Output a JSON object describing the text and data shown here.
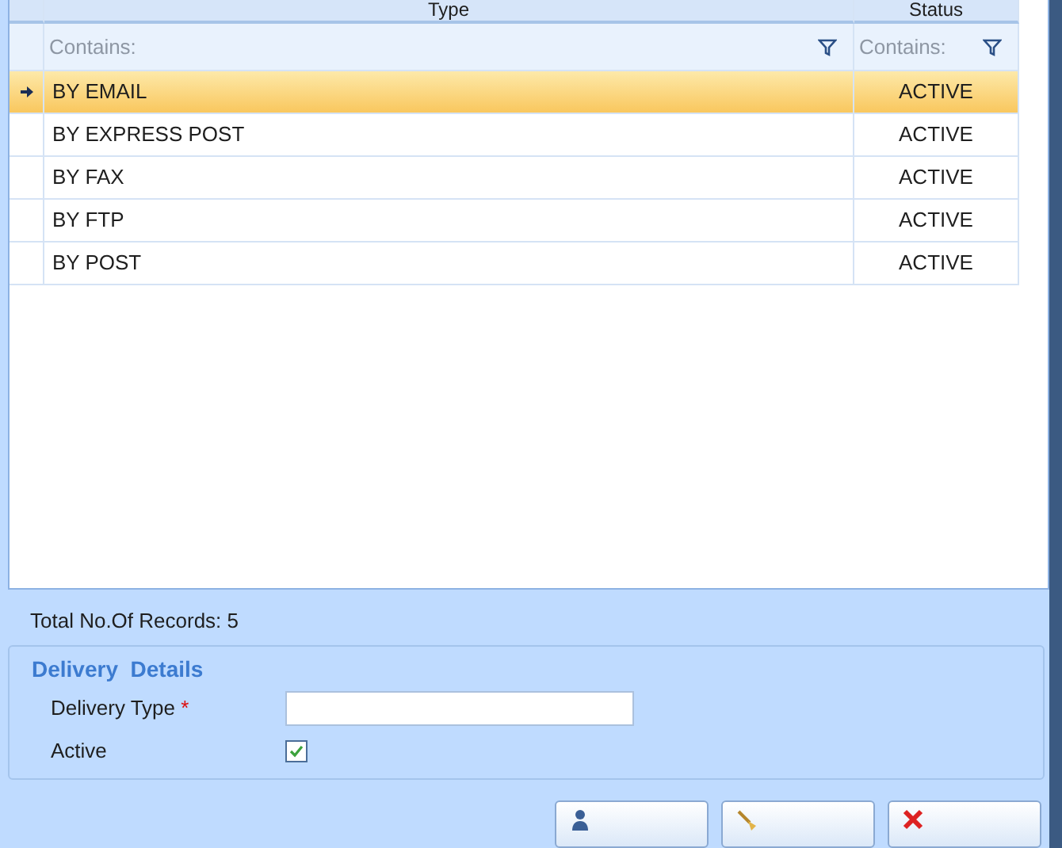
{
  "grid": {
    "columns": [
      {
        "label": "Type",
        "filter_placeholder": "Contains:"
      },
      {
        "label": "Status",
        "filter_placeholder": "Contains:"
      }
    ],
    "rows": [
      {
        "type": "BY EMAIL",
        "status": "ACTIVE",
        "selected": true
      },
      {
        "type": "BY EXPRESS POST",
        "status": "ACTIVE",
        "selected": false
      },
      {
        "type": "BY FAX",
        "status": "ACTIVE",
        "selected": false
      },
      {
        "type": "BY FTP",
        "status": "ACTIVE",
        "selected": false
      },
      {
        "type": "BY POST",
        "status": "ACTIVE",
        "selected": false
      }
    ]
  },
  "record_count": "Total No.Of Records: 5",
  "details": {
    "title": "Delivery  Details",
    "fields": [
      {
        "kind": "text",
        "label": "Delivery Type",
        "required_mark": "*"
      },
      {
        "kind": "checkbox",
        "label": "Active",
        "checked": true
      }
    ]
  },
  "buttons": [
    {
      "kind": "add"
    },
    {
      "kind": "clear"
    },
    {
      "kind": "close"
    }
  ]
}
